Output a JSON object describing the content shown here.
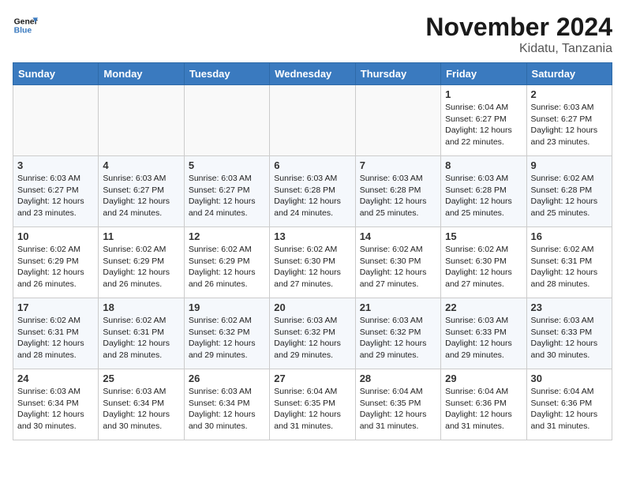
{
  "header": {
    "logo_line1": "General",
    "logo_line2": "Blue",
    "month": "November 2024",
    "location": "Kidatu, Tanzania"
  },
  "days_of_week": [
    "Sunday",
    "Monday",
    "Tuesday",
    "Wednesday",
    "Thursday",
    "Friday",
    "Saturday"
  ],
  "weeks": [
    [
      {
        "day": "",
        "info": ""
      },
      {
        "day": "",
        "info": ""
      },
      {
        "day": "",
        "info": ""
      },
      {
        "day": "",
        "info": ""
      },
      {
        "day": "",
        "info": ""
      },
      {
        "day": "1",
        "info": "Sunrise: 6:04 AM\nSunset: 6:27 PM\nDaylight: 12 hours\nand 22 minutes."
      },
      {
        "day": "2",
        "info": "Sunrise: 6:03 AM\nSunset: 6:27 PM\nDaylight: 12 hours\nand 23 minutes."
      }
    ],
    [
      {
        "day": "3",
        "info": "Sunrise: 6:03 AM\nSunset: 6:27 PM\nDaylight: 12 hours\nand 23 minutes."
      },
      {
        "day": "4",
        "info": "Sunrise: 6:03 AM\nSunset: 6:27 PM\nDaylight: 12 hours\nand 24 minutes."
      },
      {
        "day": "5",
        "info": "Sunrise: 6:03 AM\nSunset: 6:27 PM\nDaylight: 12 hours\nand 24 minutes."
      },
      {
        "day": "6",
        "info": "Sunrise: 6:03 AM\nSunset: 6:28 PM\nDaylight: 12 hours\nand 24 minutes."
      },
      {
        "day": "7",
        "info": "Sunrise: 6:03 AM\nSunset: 6:28 PM\nDaylight: 12 hours\nand 25 minutes."
      },
      {
        "day": "8",
        "info": "Sunrise: 6:03 AM\nSunset: 6:28 PM\nDaylight: 12 hours\nand 25 minutes."
      },
      {
        "day": "9",
        "info": "Sunrise: 6:02 AM\nSunset: 6:28 PM\nDaylight: 12 hours\nand 25 minutes."
      }
    ],
    [
      {
        "day": "10",
        "info": "Sunrise: 6:02 AM\nSunset: 6:29 PM\nDaylight: 12 hours\nand 26 minutes."
      },
      {
        "day": "11",
        "info": "Sunrise: 6:02 AM\nSunset: 6:29 PM\nDaylight: 12 hours\nand 26 minutes."
      },
      {
        "day": "12",
        "info": "Sunrise: 6:02 AM\nSunset: 6:29 PM\nDaylight: 12 hours\nand 26 minutes."
      },
      {
        "day": "13",
        "info": "Sunrise: 6:02 AM\nSunset: 6:30 PM\nDaylight: 12 hours\nand 27 minutes."
      },
      {
        "day": "14",
        "info": "Sunrise: 6:02 AM\nSunset: 6:30 PM\nDaylight: 12 hours\nand 27 minutes."
      },
      {
        "day": "15",
        "info": "Sunrise: 6:02 AM\nSunset: 6:30 PM\nDaylight: 12 hours\nand 27 minutes."
      },
      {
        "day": "16",
        "info": "Sunrise: 6:02 AM\nSunset: 6:31 PM\nDaylight: 12 hours\nand 28 minutes."
      }
    ],
    [
      {
        "day": "17",
        "info": "Sunrise: 6:02 AM\nSunset: 6:31 PM\nDaylight: 12 hours\nand 28 minutes."
      },
      {
        "day": "18",
        "info": "Sunrise: 6:02 AM\nSunset: 6:31 PM\nDaylight: 12 hours\nand 28 minutes."
      },
      {
        "day": "19",
        "info": "Sunrise: 6:02 AM\nSunset: 6:32 PM\nDaylight: 12 hours\nand 29 minutes."
      },
      {
        "day": "20",
        "info": "Sunrise: 6:03 AM\nSunset: 6:32 PM\nDaylight: 12 hours\nand 29 minutes."
      },
      {
        "day": "21",
        "info": "Sunrise: 6:03 AM\nSunset: 6:32 PM\nDaylight: 12 hours\nand 29 minutes."
      },
      {
        "day": "22",
        "info": "Sunrise: 6:03 AM\nSunset: 6:33 PM\nDaylight: 12 hours\nand 29 minutes."
      },
      {
        "day": "23",
        "info": "Sunrise: 6:03 AM\nSunset: 6:33 PM\nDaylight: 12 hours\nand 30 minutes."
      }
    ],
    [
      {
        "day": "24",
        "info": "Sunrise: 6:03 AM\nSunset: 6:34 PM\nDaylight: 12 hours\nand 30 minutes."
      },
      {
        "day": "25",
        "info": "Sunrise: 6:03 AM\nSunset: 6:34 PM\nDaylight: 12 hours\nand 30 minutes."
      },
      {
        "day": "26",
        "info": "Sunrise: 6:03 AM\nSunset: 6:34 PM\nDaylight: 12 hours\nand 30 minutes."
      },
      {
        "day": "27",
        "info": "Sunrise: 6:04 AM\nSunset: 6:35 PM\nDaylight: 12 hours\nand 31 minutes."
      },
      {
        "day": "28",
        "info": "Sunrise: 6:04 AM\nSunset: 6:35 PM\nDaylight: 12 hours\nand 31 minutes."
      },
      {
        "day": "29",
        "info": "Sunrise: 6:04 AM\nSunset: 6:36 PM\nDaylight: 12 hours\nand 31 minutes."
      },
      {
        "day": "30",
        "info": "Sunrise: 6:04 AM\nSunset: 6:36 PM\nDaylight: 12 hours\nand 31 minutes."
      }
    ]
  ]
}
